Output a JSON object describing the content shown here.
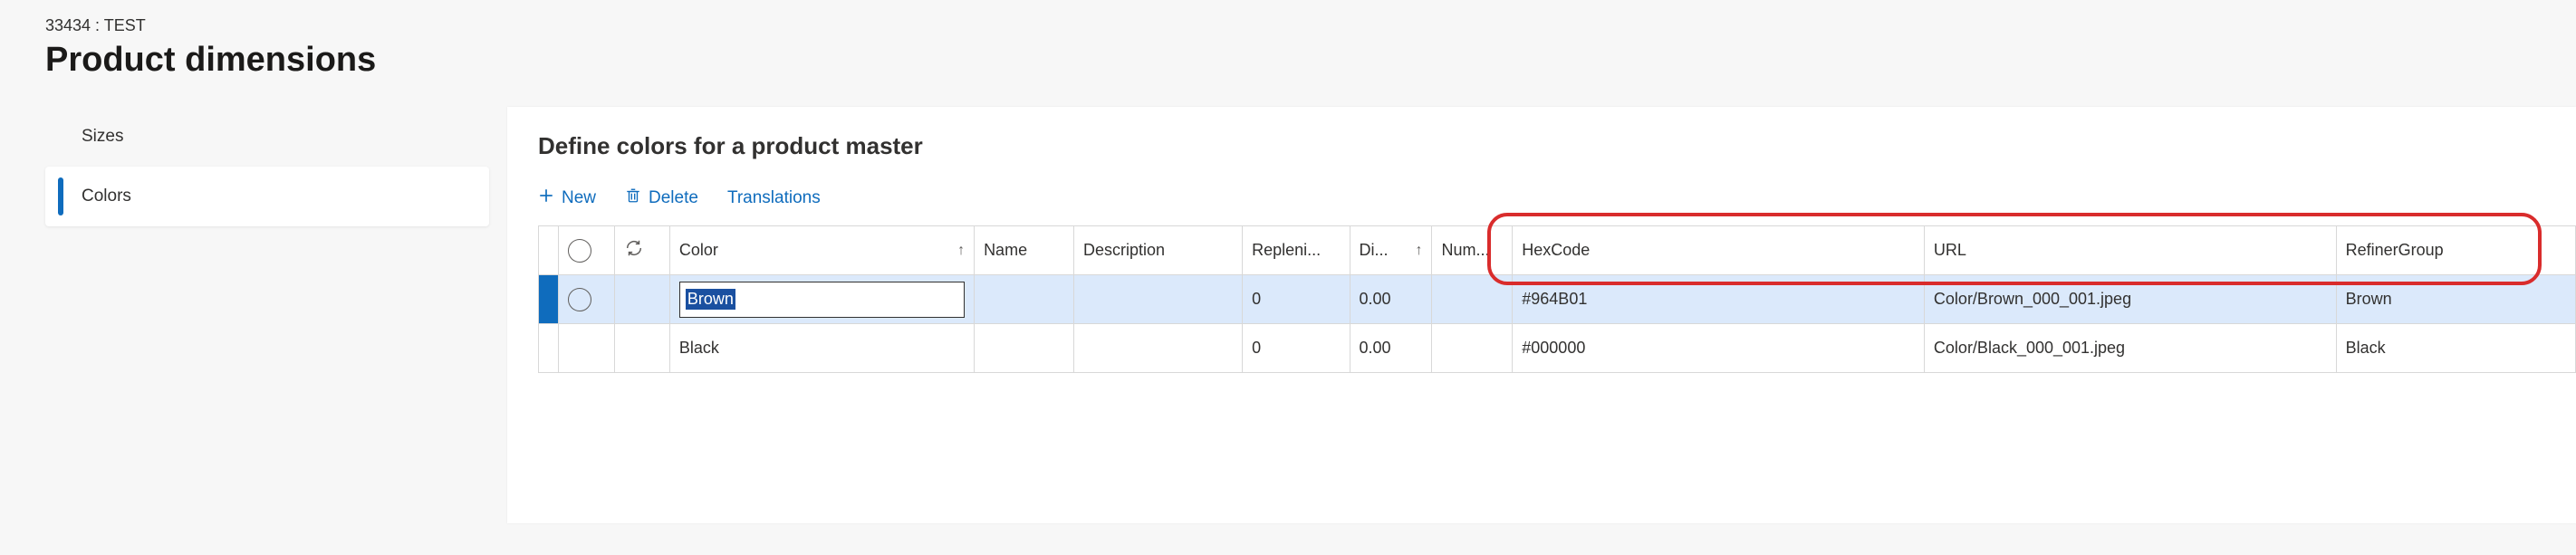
{
  "breadcrumb": "33434 : TEST",
  "page_title": "Product dimensions",
  "sidebar": {
    "items": [
      {
        "label": "Sizes",
        "selected": false
      },
      {
        "label": "Colors",
        "selected": true
      }
    ]
  },
  "panel": {
    "title": "Define colors for a product master",
    "toolbar": {
      "new_label": "New",
      "delete_label": "Delete",
      "translations_label": "Translations"
    },
    "columns": {
      "color": "Color",
      "name": "Name",
      "description": "Description",
      "replenishment": "Repleni...",
      "display": "Di...",
      "number": "Num...",
      "hexcode": "HexCode",
      "url": "URL",
      "refiner": "RefinerGroup"
    },
    "rows": [
      {
        "selected": true,
        "editing": true,
        "color": "Brown",
        "name": "",
        "description": "",
        "replenishment": "0",
        "display": "0.00",
        "number": "",
        "hexcode": "#964B01",
        "url": "Color/Brown_000_001.jpeg",
        "refiner": "Brown"
      },
      {
        "selected": false,
        "editing": false,
        "color": "Black",
        "name": "",
        "description": "",
        "replenishment": "0",
        "display": "0.00",
        "number": "",
        "hexcode": "#000000",
        "url": "Color/Black_000_001.jpeg",
        "refiner": "Black"
      }
    ]
  }
}
